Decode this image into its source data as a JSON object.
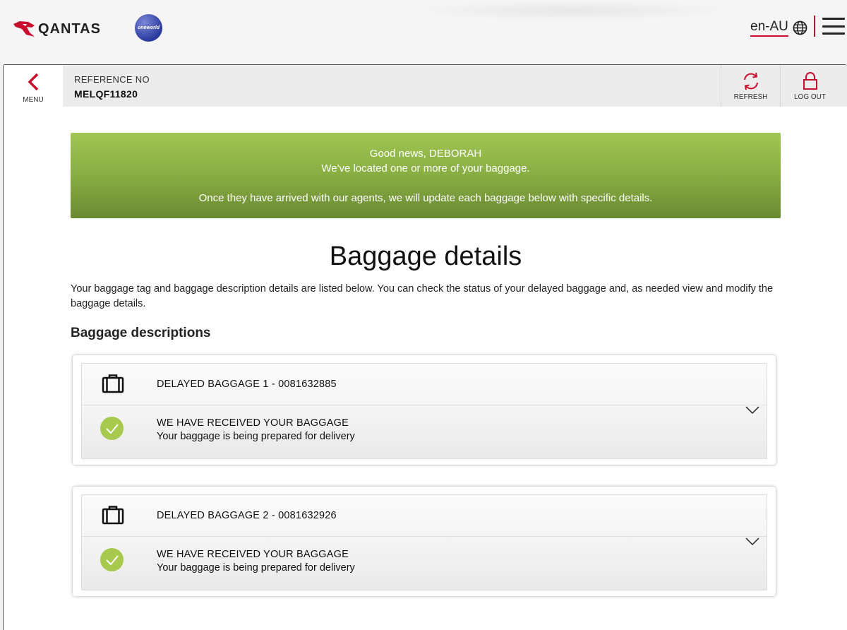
{
  "header": {
    "brand": "QANTAS",
    "alliance": "oneworld",
    "language": "en-AU",
    "accent_color": "#c8102e"
  },
  "refbar": {
    "menu_label": "MENU",
    "reference_label": "REFERENCE NO",
    "reference_value": "MELQF11820",
    "refresh_label": "REFRESH",
    "logout_label": "LOG OUT"
  },
  "banner": {
    "line1": "Good news, DEBORAH",
    "line2": "We've located one or more of your baggage.",
    "line3": "Once they have arrived with our agents, we will update each baggage below with specific details.",
    "color": "#88ad43"
  },
  "page": {
    "title": "Baggage details",
    "intro": "Your baggage tag and baggage description details are listed below. You can check the status of your delayed baggage and, as needed view and modify the baggage details.",
    "section_title": "Baggage descriptions"
  },
  "baggage": [
    {
      "title": "DELAYED BAGGAGE 1 - 0081632885",
      "status_title": "WE HAVE RECEIVED YOUR BAGGAGE",
      "status_detail": "Your baggage is being prepared for delivery",
      "icon": "suitcase-icon",
      "status_icon": "check-circle-icon"
    },
    {
      "title": "DELAYED BAGGAGE 2 - 0081632926",
      "status_title": "WE HAVE RECEIVED YOUR BAGGAGE",
      "status_detail": "Your baggage is being prepared for delivery",
      "icon": "suitcase-icon",
      "status_icon": "check-circle-icon"
    }
  ]
}
